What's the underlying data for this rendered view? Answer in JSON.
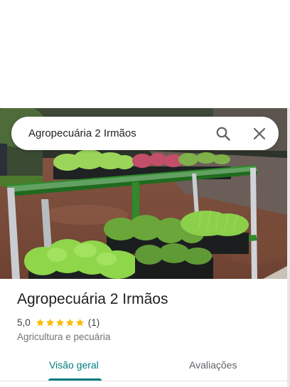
{
  "search": {
    "query": "Agropecuária 2 Irmãos"
  },
  "place": {
    "name": "Agropecuária 2 Irmãos",
    "rating": "5,0",
    "stars": 5,
    "review_count": "(1)",
    "category": "Agricultura e pecuária"
  },
  "tabs": [
    {
      "label": "Visão geral",
      "selected": true
    },
    {
      "label": "Avaliações",
      "selected": false
    }
  ],
  "colors": {
    "accent": "#017d80",
    "star": "#fbbc04"
  },
  "icons": {
    "search": "search-icon",
    "close": "close-icon",
    "star": "star-icon"
  }
}
